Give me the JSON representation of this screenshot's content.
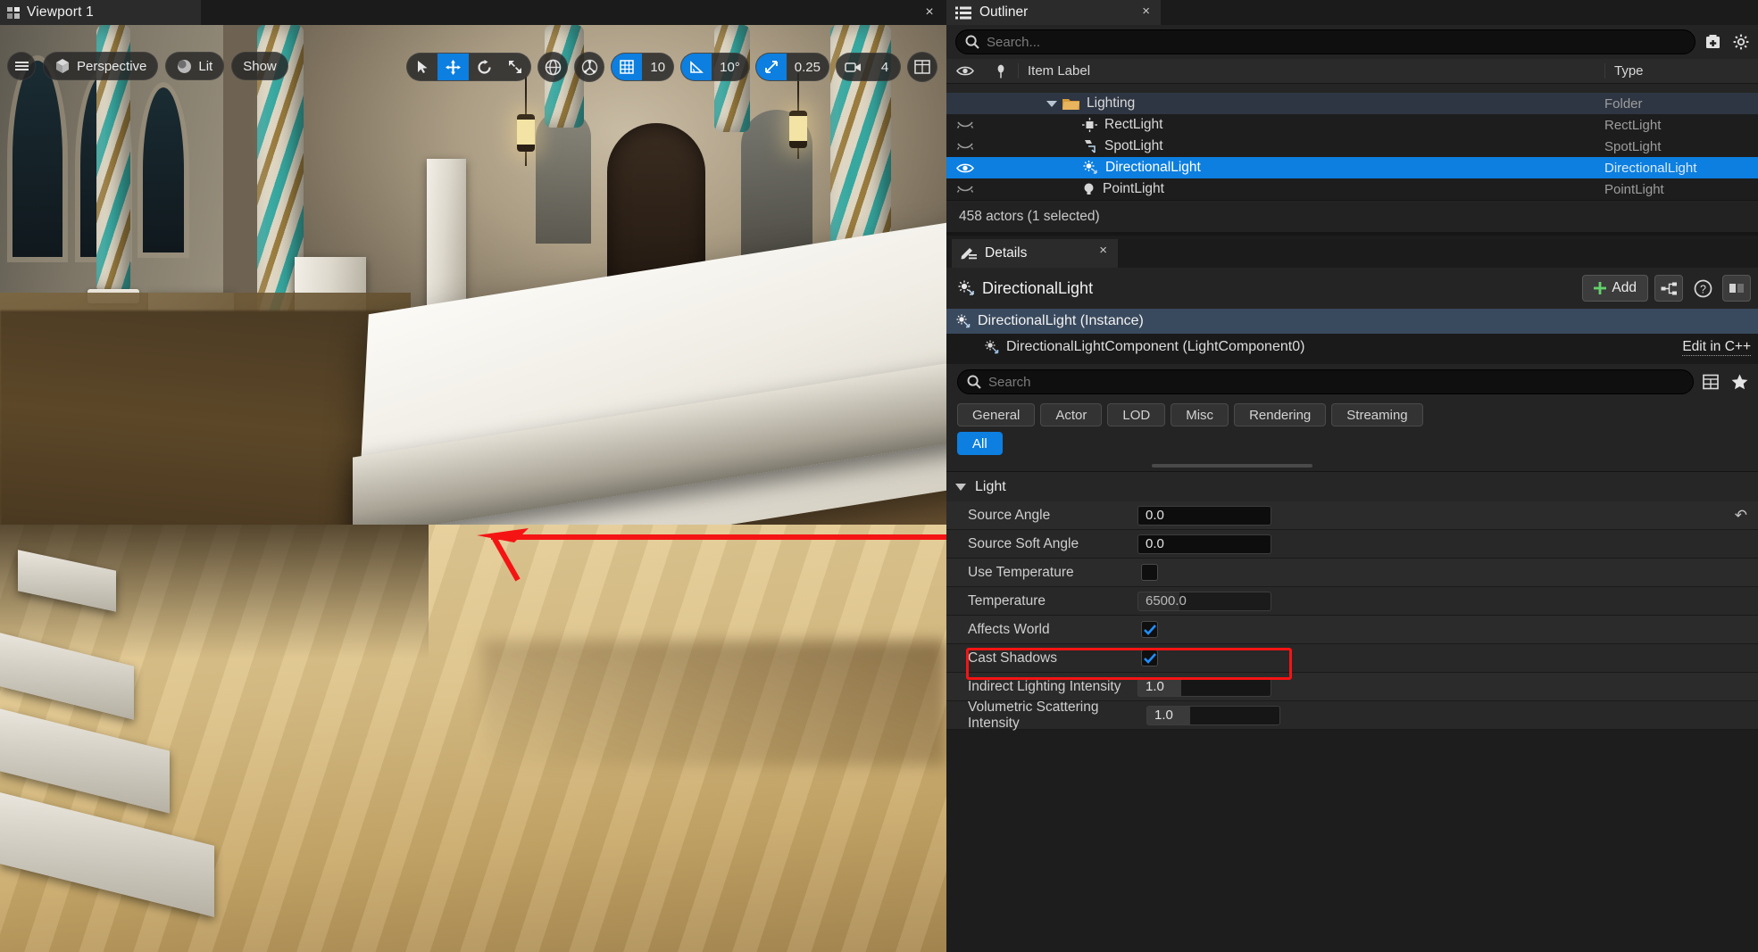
{
  "viewport": {
    "tab_label": "Viewport 1",
    "close_label": "×",
    "menu_icon": "hamburger-icon",
    "camera_mode": "Perspective",
    "view_mode": "Lit",
    "show_menu": "Show",
    "tools": {
      "select_icon": "cursor-select-icon",
      "move_icon": "move-gizmo-icon",
      "rotate_icon": "rotate-gizmo-icon",
      "scale_icon": "scale-gizmo-icon",
      "coordinate_icon": "world-globe-icon",
      "pivot_icon": "pivot-icon",
      "grid_icon": "grid-snap-icon",
      "grid_value": "10",
      "angle_icon": "angle-snap-icon",
      "angle_value": "10°",
      "scale_snap_icon": "scale-snap-icon",
      "scale_snap_value": "0.25",
      "camera_speed_icon": "camera-icon",
      "camera_speed_value": "4",
      "layout_icon": "viewport-layout-icon"
    }
  },
  "outliner": {
    "tab_label": "Outliner",
    "tab_icon": "outliner-icon",
    "close_label": "×",
    "search_placeholder": "Search...",
    "search_value": "",
    "add_icon": "add-folder-icon",
    "settings_icon": "gear-icon",
    "columns": {
      "eye": "eye-icon",
      "pin": "pin-icon",
      "label": "Item Label",
      "type": "Type"
    },
    "rows": [
      {
        "label": "",
        "type": "",
        "icon": "clipped-row",
        "state": "clipped",
        "indent": 0
      },
      {
        "label": "Lighting",
        "type": "Folder",
        "icon": "folder-icon",
        "state": "folder",
        "indent": 1
      },
      {
        "label": "RectLight",
        "type": "RectLight",
        "icon": "rect-light-icon",
        "state": "hidden",
        "indent": 2
      },
      {
        "label": "SpotLight",
        "type": "SpotLight",
        "icon": "spot-light-icon",
        "state": "hidden",
        "indent": 2
      },
      {
        "label": "DirectionalLight",
        "type": "DirectionalLight",
        "icon": "directional-light-icon",
        "state": "selected",
        "indent": 2
      },
      {
        "label": "PointLight",
        "type": "PointLight",
        "icon": "point-light-icon",
        "state": "hidden",
        "indent": 2
      }
    ],
    "status": "458 actors (1 selected)"
  },
  "details": {
    "tab_label": "Details",
    "tab_icon": "details-pencil-icon",
    "close_label": "×",
    "actor_name": "DirectionalLight",
    "actor_icon": "directional-light-icon",
    "add_label": "Add",
    "add_icon": "plus-icon",
    "blueprint_icon": "blueprint-graph-icon",
    "help_icon": "help-question-icon",
    "component_root": "DirectionalLight (Instance)",
    "component_child": "DirectionalLightComponent (LightComponent0)",
    "edit_in_cpp": "Edit in C++",
    "search_placeholder": "Search",
    "search_value": "",
    "column_icon": "column-settings-icon",
    "favorite_icon": "star-icon",
    "filter_tabs": [
      "General",
      "Actor",
      "LOD",
      "Misc",
      "Rendering",
      "Streaming"
    ],
    "filter_tabs_row2": [
      {
        "label": "All",
        "active": true
      }
    ],
    "section_light": "Light",
    "properties": [
      {
        "label": "Source Angle",
        "value": "0.0",
        "kind": "number",
        "highlighted": true,
        "reset": "↶"
      },
      {
        "label": "Source Soft Angle",
        "value": "0.0",
        "kind": "number"
      },
      {
        "label": "Use Temperature",
        "value": "",
        "kind": "checkbox",
        "checked": false
      },
      {
        "label": "Temperature",
        "value": "6500.0",
        "kind": "slider",
        "disabled": true
      },
      {
        "label": "Affects World",
        "value": "",
        "kind": "checkbox",
        "checked": true
      },
      {
        "label": "Cast Shadows",
        "value": "",
        "kind": "checkbox",
        "checked": true
      },
      {
        "label": "Indirect Lighting Intensity",
        "value": "1.0",
        "kind": "number-grab"
      },
      {
        "label": "Volumetric Scattering Intensity",
        "value": "1.0",
        "kind": "number-grab"
      }
    ]
  },
  "annotation": {
    "arrow_color": "#f51414",
    "highlight_color": "#f51414"
  },
  "colors": {
    "accent": "#0c7fe0",
    "panel_bg": "#242424",
    "row_bg": "#2b2b2b",
    "selection": "#0c7fe0"
  }
}
